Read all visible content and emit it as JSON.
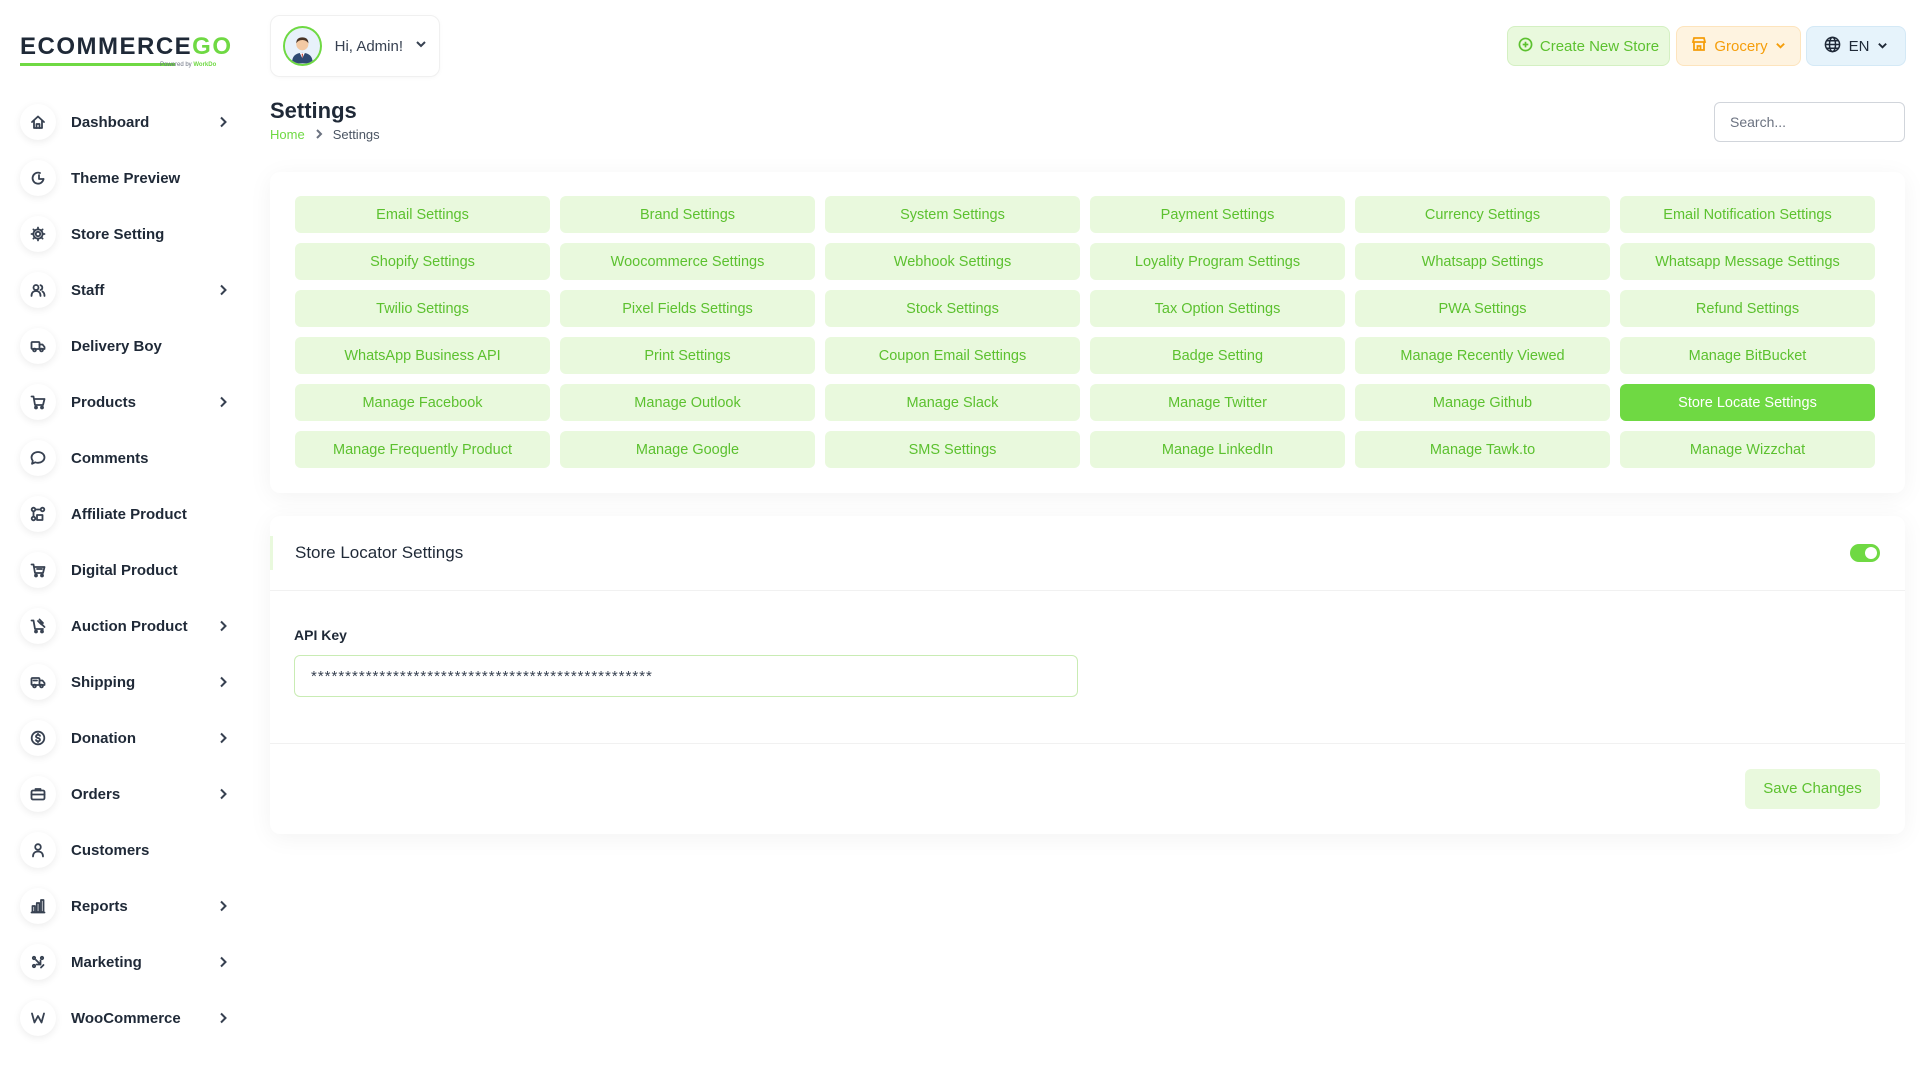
{
  "brand": {
    "logo_main": "ECOMMERCE",
    "logo_accent": "GO",
    "logo_sub_prefix": "Powered by",
    "logo_sub_brand": "WorkDo",
    "accent_color": "#6fd943"
  },
  "sidebar": {
    "items": [
      {
        "label": "Dashboard",
        "icon": "home-icon",
        "has_children": true
      },
      {
        "label": "Theme Preview",
        "icon": "palette-icon",
        "has_children": false
      },
      {
        "label": "Store Setting",
        "icon": "gear-icon",
        "has_children": false
      },
      {
        "label": "Staff",
        "icon": "users-icon",
        "has_children": true
      },
      {
        "label": "Delivery Boy",
        "icon": "truck-icon",
        "has_children": false
      },
      {
        "label": "Products",
        "icon": "cart-icon",
        "has_children": true
      },
      {
        "label": "Comments",
        "icon": "chat-icon",
        "has_children": false
      },
      {
        "label": "Affiliate Product",
        "icon": "affiliate-icon",
        "has_children": false
      },
      {
        "label": "Digital Product",
        "icon": "digital-cart-icon",
        "has_children": false
      },
      {
        "label": "Auction Product",
        "icon": "auction-icon",
        "has_children": true
      },
      {
        "label": "Shipping",
        "icon": "shipping-icon",
        "has_children": true
      },
      {
        "label": "Donation",
        "icon": "coin-icon",
        "has_children": true
      },
      {
        "label": "Orders",
        "icon": "briefcase-icon",
        "has_children": true
      },
      {
        "label": "Customers",
        "icon": "user-icon",
        "has_children": false
      },
      {
        "label": "Reports",
        "icon": "chart-icon",
        "has_children": true
      },
      {
        "label": "Marketing",
        "icon": "marketing-icon",
        "has_children": true
      },
      {
        "label": "WooCommerce",
        "icon": "woocommerce-icon",
        "has_children": true
      }
    ]
  },
  "header": {
    "greeting": "Hi, Admin!",
    "create_store_label": "Create New Store",
    "store_label": "Grocery",
    "language_label": "EN"
  },
  "page": {
    "title": "Settings",
    "breadcrumb_home": "Home",
    "breadcrumb_current": "Settings",
    "search_placeholder": "Search..."
  },
  "settings_tabs": [
    {
      "label": "Email Settings",
      "active": false
    },
    {
      "label": "Brand Settings",
      "active": false
    },
    {
      "label": "System Settings",
      "active": false
    },
    {
      "label": "Payment Settings",
      "active": false
    },
    {
      "label": "Currency Settings",
      "active": false
    },
    {
      "label": "Email Notification Settings",
      "active": false
    },
    {
      "label": "Shopify Settings",
      "active": false
    },
    {
      "label": "Woocommerce Settings",
      "active": false
    },
    {
      "label": "Webhook Settings",
      "active": false
    },
    {
      "label": "Loyality Program Settings",
      "active": false
    },
    {
      "label": "Whatsapp Settings",
      "active": false
    },
    {
      "label": "Whatsapp Message Settings",
      "active": false
    },
    {
      "label": "Twilio Settings",
      "active": false
    },
    {
      "label": "Pixel Fields Settings",
      "active": false
    },
    {
      "label": "Stock Settings",
      "active": false
    },
    {
      "label": "Tax Option Settings",
      "active": false
    },
    {
      "label": "PWA Settings",
      "active": false
    },
    {
      "label": "Refund Settings",
      "active": false
    },
    {
      "label": "WhatsApp Business API",
      "active": false
    },
    {
      "label": "Print Settings",
      "active": false
    },
    {
      "label": "Coupon Email Settings",
      "active": false
    },
    {
      "label": "Badge Setting",
      "active": false
    },
    {
      "label": "Manage Recently Viewed",
      "active": false
    },
    {
      "label": "Manage BitBucket",
      "active": false
    },
    {
      "label": "Manage Facebook",
      "active": false
    },
    {
      "label": "Manage Outlook",
      "active": false
    },
    {
      "label": "Manage Slack",
      "active": false
    },
    {
      "label": "Manage Twitter",
      "active": false
    },
    {
      "label": "Manage Github",
      "active": false
    },
    {
      "label": "Store Locate Settings",
      "active": true
    },
    {
      "label": "Manage Frequently Product",
      "active": false
    },
    {
      "label": "Manage Google",
      "active": false
    },
    {
      "label": "SMS Settings",
      "active": false
    },
    {
      "label": "Manage LinkedIn",
      "active": false
    },
    {
      "label": "Manage Tawk.to",
      "active": false
    },
    {
      "label": "Manage Wizzchat",
      "active": false
    }
  ],
  "store_locator": {
    "title": "Store Locator Settings",
    "enabled": true,
    "api_key_label": "API Key",
    "api_key_value": "**************************************************",
    "save_label": "Save Changes"
  }
}
